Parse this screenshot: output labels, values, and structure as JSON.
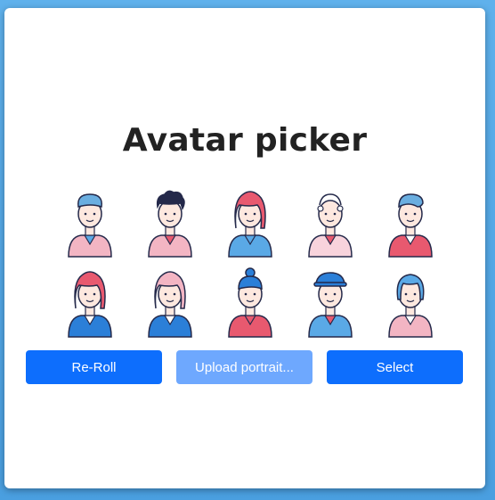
{
  "title": "Avatar picker",
  "avatars": [
    {
      "name": "avatar-1",
      "hair": "#6aaee0",
      "skin": "#fde8df",
      "shirt": "#f3b5c3",
      "inner": "#5aa9e6",
      "style": "short"
    },
    {
      "name": "avatar-2",
      "hair": "#24294a",
      "skin": "#fde8df",
      "shirt": "#f3b5c3",
      "inner": "#e8596f",
      "style": "curly"
    },
    {
      "name": "avatar-3",
      "hair": "#e8596f",
      "skin": "#fde8df",
      "shirt": "#5aa9e6",
      "inner": "#5aa9e6",
      "style": "long"
    },
    {
      "name": "avatar-4",
      "hair": "#ffffff",
      "skin": "#fde8df",
      "shirt": "#f8d3dc",
      "inner": "#e8596f",
      "style": "bald"
    },
    {
      "name": "avatar-5",
      "hair": "#6aaee0",
      "skin": "#fde8df",
      "shirt": "#e8596f",
      "inner": "#ffffff",
      "style": "side"
    },
    {
      "name": "avatar-6",
      "hair": "#e8596f",
      "skin": "#fde8df",
      "shirt": "#2b7fd8",
      "inner": "#ffffff",
      "style": "long"
    },
    {
      "name": "avatar-7",
      "hair": "#f3b5c3",
      "skin": "#fde8df",
      "shirt": "#2b7fd8",
      "inner": "#ffffff",
      "style": "long"
    },
    {
      "name": "avatar-8",
      "hair": "#2b7fd8",
      "skin": "#fde8df",
      "shirt": "#e8596f",
      "inner": "#e8596f",
      "style": "bun"
    },
    {
      "name": "avatar-9",
      "hair": "#2b7fd8",
      "skin": "#fde8df",
      "shirt": "#5aa9e6",
      "inner": "#e8596f",
      "style": "hat"
    },
    {
      "name": "avatar-10",
      "hair": "#5aa9e6",
      "skin": "#fde8df",
      "shirt": "#f3b5c3",
      "inner": "#ffffff",
      "style": "bob"
    }
  ],
  "buttons": {
    "reroll": "Re-Roll",
    "upload": "Upload portrait...",
    "select": "Select"
  },
  "colors": {
    "primary": "#0d6efd",
    "disabled": "#6ea8fe",
    "background": "#5fb1ec"
  }
}
